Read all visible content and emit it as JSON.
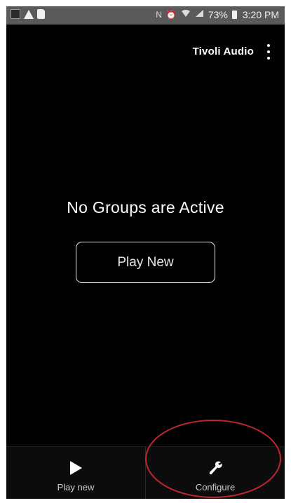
{
  "status_bar": {
    "battery": "73%",
    "time": "3:20 PM",
    "icons": [
      "app-icon",
      "warning-icon",
      "sd-card-icon",
      "nfc-icon",
      "alarm-icon",
      "wifi-icon",
      "signal-icon",
      "battery-icon"
    ]
  },
  "header": {
    "brand": "Tivoli Audio",
    "menu_icon": "more-vert-icon"
  },
  "main": {
    "empty_message": "No Groups are Active",
    "play_new_button": "Play New"
  },
  "bottom_nav": {
    "tabs": [
      {
        "label": "Play new",
        "icon": "play-icon"
      },
      {
        "label": "Configure",
        "icon": "wrench-icon"
      }
    ]
  },
  "annotation": {
    "color": "#c0262c"
  }
}
